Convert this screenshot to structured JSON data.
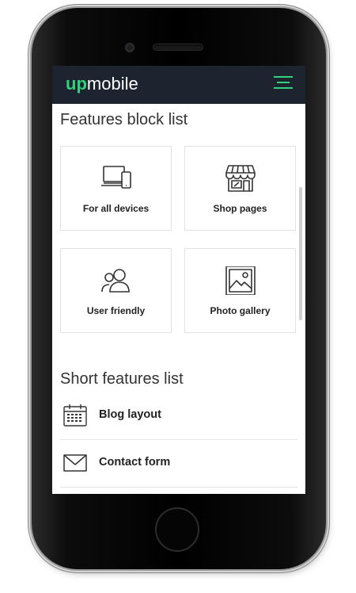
{
  "brand": {
    "prefix": "up",
    "suffix": "mobile",
    "accent": "#33d17a",
    "header_bg": "#1e2330"
  },
  "features_block": {
    "title": "Features block list",
    "items": [
      {
        "label": "For all devices",
        "icon": "devices-icon"
      },
      {
        "label": "Shop pages",
        "icon": "shop-icon"
      },
      {
        "label": "User friendly",
        "icon": "users-icon"
      },
      {
        "label": "Photo gallery",
        "icon": "photo-icon"
      }
    ]
  },
  "short_features": {
    "title": "Short features list",
    "items": [
      {
        "label": "Blog layout",
        "icon": "calendar-icon"
      },
      {
        "label": "Contact form",
        "icon": "envelope-icon"
      }
    ]
  }
}
